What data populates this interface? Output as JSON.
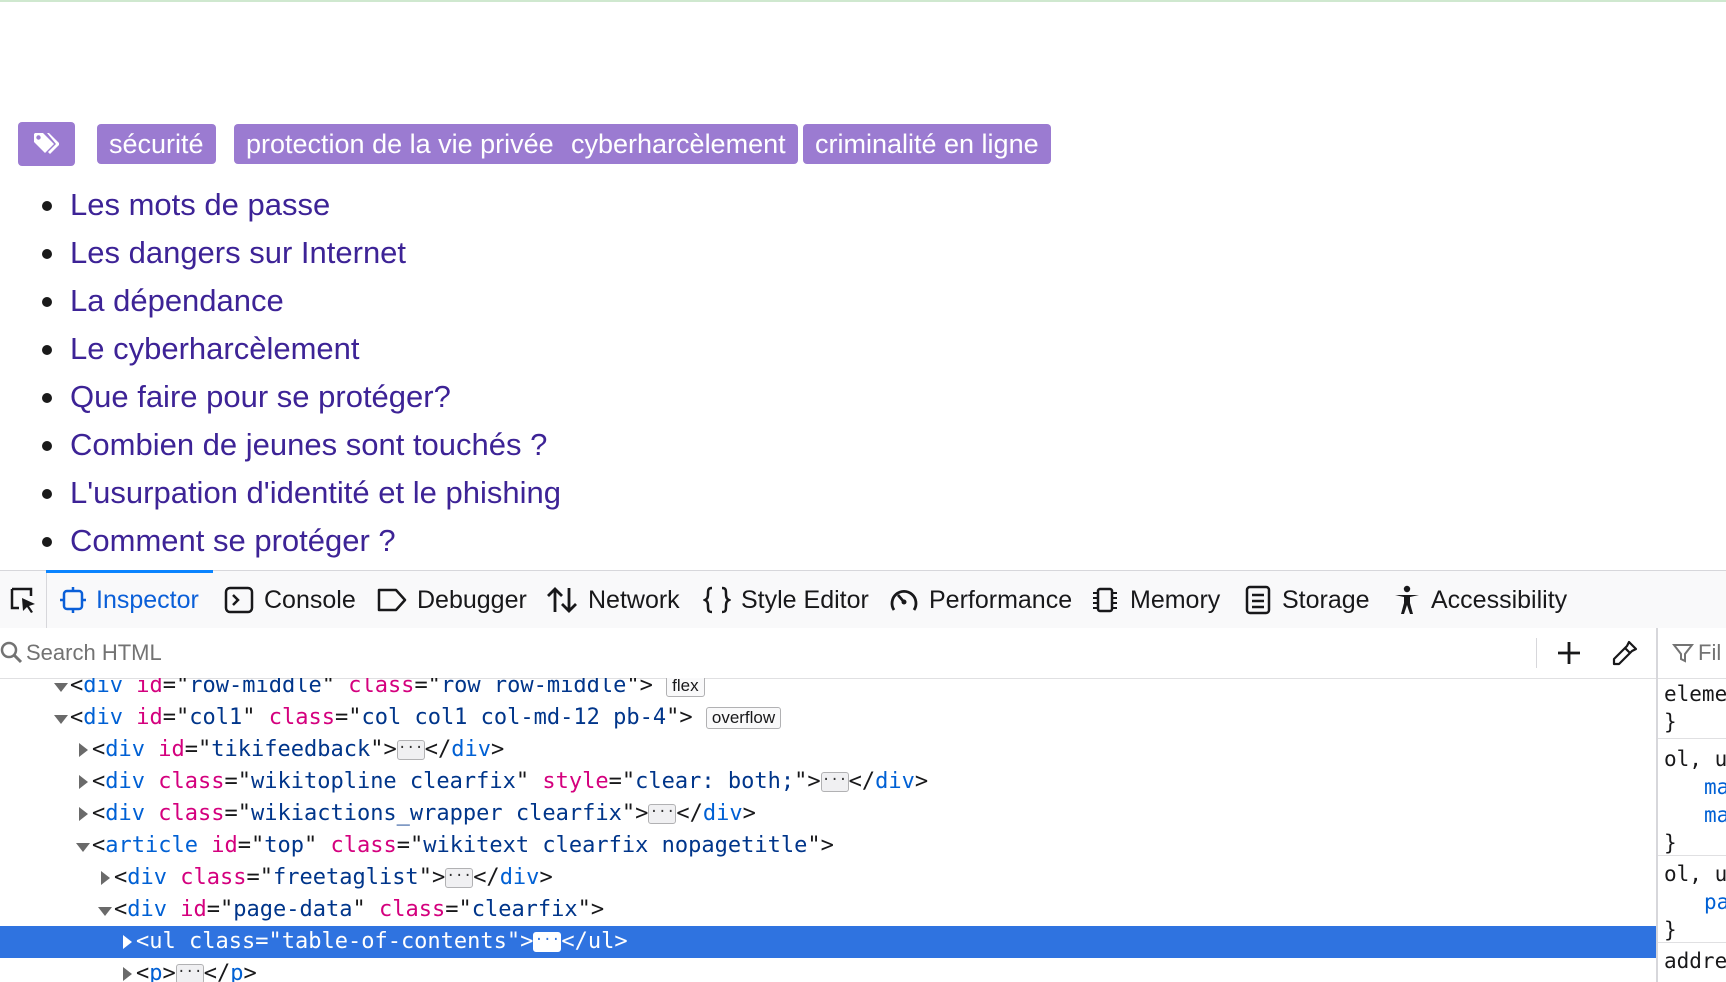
{
  "tags": {
    "icon": "tags-icon",
    "items": [
      "sécurité",
      "protection de la vie privée",
      "cyberharcèlement",
      "criminalité en ligne"
    ]
  },
  "toc": {
    "items": [
      "Les mots de passe",
      "Les dangers sur Internet",
      "La dépendance",
      "Le cyberharcèlement",
      "Que faire pour se protéger?",
      "Combien de jeunes sont touchés ?",
      "L'usurpation d'identité et le phishing",
      "Comment se protéger ?"
    ]
  },
  "devtools": {
    "tools": [
      {
        "label": "Inspector",
        "icon": "inspector-icon",
        "selected": true
      },
      {
        "label": "Console",
        "icon": "console-icon"
      },
      {
        "label": "Debugger",
        "icon": "debugger-icon"
      },
      {
        "label": "Network",
        "icon": "network-icon"
      },
      {
        "label": "Style Editor",
        "icon": "style-editor-icon"
      },
      {
        "label": "Performance",
        "icon": "performance-icon"
      },
      {
        "label": "Memory",
        "icon": "memory-icon"
      },
      {
        "label": "Storage",
        "icon": "storage-icon"
      },
      {
        "label": "Accessibility",
        "icon": "accessibility-icon"
      }
    ],
    "search": {
      "placeholder": "Search HTML"
    },
    "rules_filter": {
      "placeholder": "Fil"
    },
    "markup": [
      {
        "open": true,
        "tag": "div",
        "attrs": [
          [
            "id",
            "row-middle"
          ],
          [
            "class",
            "row row-middle"
          ]
        ],
        "badge": "flex"
      },
      {
        "open": true,
        "tag": "div",
        "attrs": [
          [
            "id",
            "col1"
          ],
          [
            "class",
            "col col1 col-md-12 pb-4"
          ]
        ],
        "badge": "overflow"
      },
      {
        "open": false,
        "tag": "div",
        "attrs": [
          [
            "id",
            "tikifeedback"
          ]
        ]
      },
      {
        "open": false,
        "tag": "div",
        "attrs": [
          [
            "class",
            "wikitopline clearfix"
          ],
          [
            "style",
            "clear: both;"
          ]
        ]
      },
      {
        "open": false,
        "tag": "div",
        "attrs": [
          [
            "class",
            "wikiactions_wrapper clearfix"
          ]
        ]
      },
      {
        "open": true,
        "tag": "article",
        "attrs": [
          [
            "id",
            "top"
          ],
          [
            "class",
            "wikitext clearfix nopagetitle"
          ]
        ]
      },
      {
        "open": false,
        "tag": "div",
        "attrs": [
          [
            "class",
            "freetaglist"
          ]
        ]
      },
      {
        "open": true,
        "tag": "div",
        "attrs": [
          [
            "id",
            "page-data"
          ],
          [
            "class",
            "clearfix"
          ]
        ]
      },
      {
        "open": false,
        "tag": "ul",
        "attrs": [
          [
            "class",
            "table-of-contents"
          ]
        ],
        "selected": true
      },
      {
        "open": false,
        "tag": "p",
        "attrs": []
      }
    ],
    "rules": [
      {
        "lines": [
          "eleme",
          "}"
        ]
      },
      {
        "lines": [
          "ol, u",
          "ma",
          "ma",
          "}"
        ]
      },
      {
        "lines": [
          "ol, u",
          "pa",
          "}"
        ]
      },
      {
        "lines": [
          "addre"
        ]
      }
    ]
  },
  "colors": {
    "tag_bg": "#9b7bd1",
    "link": "#3d2396",
    "devtools_accent": "#0a84ff",
    "selection": "#2f73e0"
  }
}
